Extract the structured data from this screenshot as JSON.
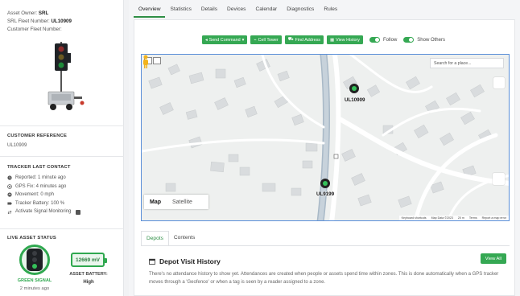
{
  "asset": {
    "owner_label": "Asset Owner:",
    "owner_value": "SRL",
    "fleet_label": "SRL Fleet Number:",
    "fleet_value": "UL10909",
    "customer_fleet_label": "Customer Fleet Number:"
  },
  "customer_reference": {
    "title": "CUSTOMER REFERENCE",
    "value": "UL10909"
  },
  "tracker": {
    "title": "TRACKER LAST CONTACT",
    "items": [
      {
        "icon": "clock-icon",
        "text": "Reported: 1 minute ago"
      },
      {
        "icon": "gps-icon",
        "text": "GPS Fix: 4 minutes ago"
      },
      {
        "icon": "movement-icon",
        "text": "Movement: 0 mph"
      },
      {
        "icon": "battery-icon",
        "text": "Tracker Battery: 100 %"
      },
      {
        "icon": "swap-icon",
        "text": "Activate Signal Monitoring"
      }
    ]
  },
  "live_status": {
    "title": "LIVE ASSET STATUS",
    "signal_label": "GREEN SIGNAL",
    "signal_time": "2 minutes ago",
    "battery_value": "12669 mV",
    "battery_label": "ASSET BATTERY:",
    "battery_level": "High",
    "signal_color": "#35c15a"
  },
  "tabs": [
    "Overview",
    "Statistics",
    "Details",
    "Devices",
    "Calendar",
    "Diagnostics",
    "Rules"
  ],
  "active_tab": "Overview",
  "toolbar": {
    "send_command": "Send Command",
    "cell_tower": "Cell Tower",
    "find_address": "Find Address",
    "view_history": "View History",
    "follow": "Follow",
    "show_others": "Show Others"
  },
  "map": {
    "search_placeholder": "Search for a place...",
    "maptype_map": "Map",
    "maptype_satellite": "Satellite",
    "pins": [
      {
        "label": "UL10909"
      },
      {
        "label": "UL9199"
      }
    ],
    "attribution": {
      "shortcuts": "Keyboard shortcuts",
      "data": "Map Data ©2023",
      "scale": "20 m",
      "terms": "Terms",
      "report": "Report a map error"
    }
  },
  "bottom_tabs": [
    "Depots",
    "Contents"
  ],
  "depot": {
    "title": "Depot Visit History",
    "view_all": "View All",
    "description": "There's no attendance history to show yet. Attendances are created when people or assets spend time within zones. This is done automatically when a GPS tracker moves through a 'Geofence' or when a tag is seen by a reader assigned to a zone."
  },
  "colors": {
    "accent_green": "#35a853",
    "map_border": "#5a8fd8"
  }
}
